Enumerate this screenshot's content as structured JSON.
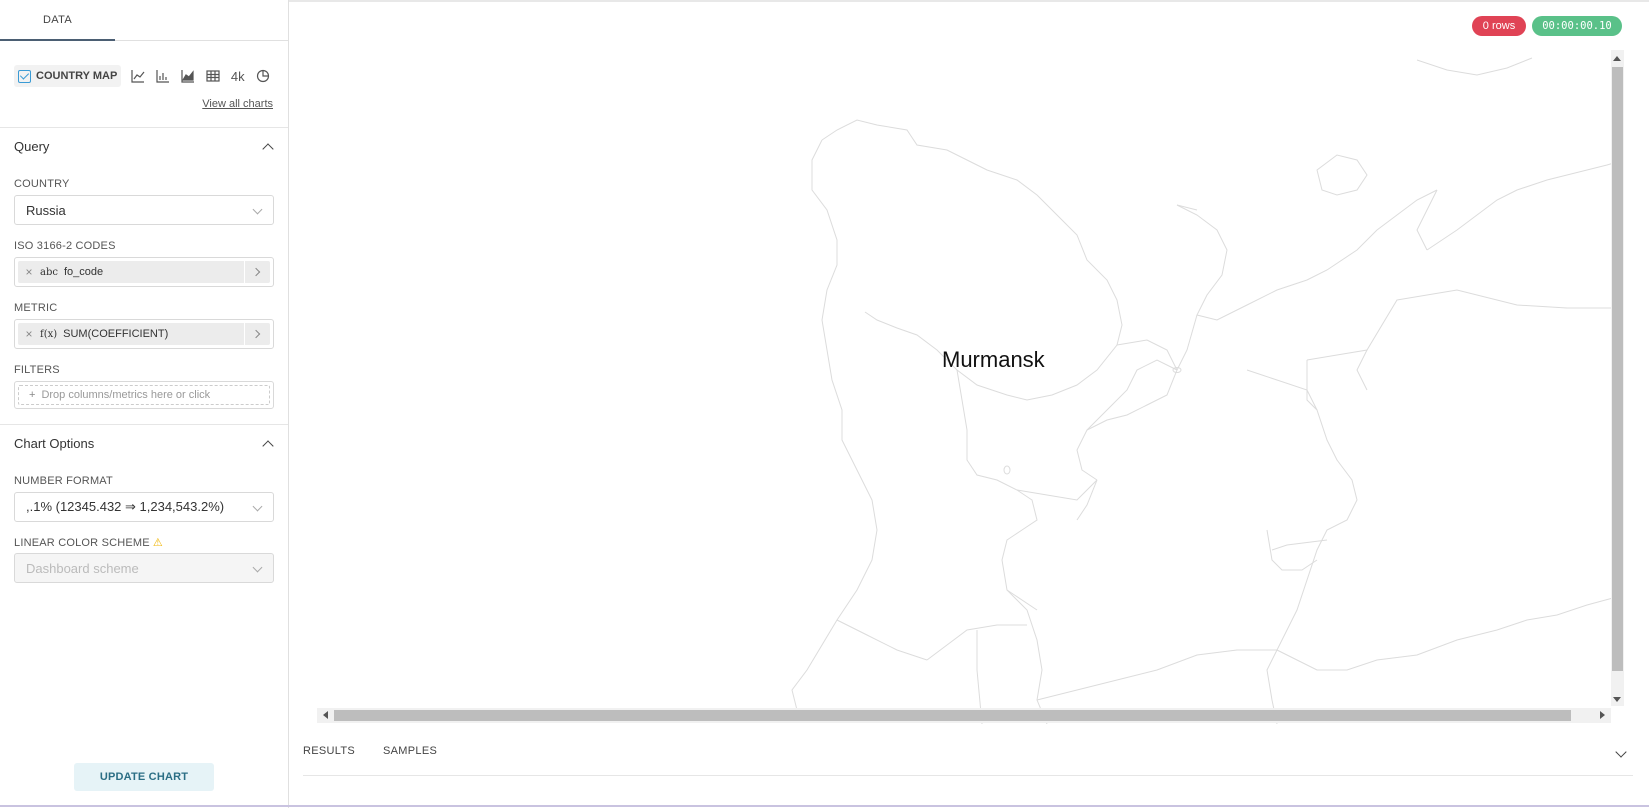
{
  "tabs": {
    "data": "DATA"
  },
  "viz": {
    "selected_label": "COUNTRY MAP",
    "icons": [
      "line-chart-icon",
      "bar-chart-icon",
      "area-chart-icon",
      "table-icon",
      "big-number-icon",
      "pie-chart-icon"
    ],
    "big_number_text": "4k",
    "view_all": "View all charts"
  },
  "query": {
    "title": "Query",
    "country_label": "COUNTRY",
    "country_value": "Russia",
    "iso_label": "ISO 3166-2 CODES",
    "iso_type": "abc",
    "iso_value": "fo_code",
    "metric_label": "METRIC",
    "metric_type": "f(x)",
    "metric_value": "SUM(COEFFICIENT)",
    "filters_label": "FILTERS",
    "filters_placeholder": "Drop columns/metrics here or click",
    "remove_glyph": "×",
    "plus_glyph": "+"
  },
  "chart_options": {
    "title": "Chart Options",
    "number_format_label": "NUMBER FORMAT",
    "number_format_value": ",.1% (12345.432 ⇒ 1,234,543.2%)",
    "color_scheme_label": "LINEAR COLOR SCHEME",
    "color_scheme_warning_glyph": "⚠",
    "color_scheme_placeholder": "Dashboard scheme"
  },
  "update_button": "UPDATE CHART",
  "status": {
    "rows": "0 rows",
    "timer": "00:00:00.10"
  },
  "map": {
    "region_label": "Murmansk"
  },
  "results_tabs": {
    "results": "RESULTS",
    "samples": "SAMPLES"
  },
  "colors": {
    "rows_badge": "#e04355",
    "timer_badge": "#5ac189",
    "accent": "#3a9bd5",
    "update_button_bg": "#e6f3f7",
    "update_button_text": "#2b6e85",
    "map_stroke": "#dcdcdc"
  }
}
